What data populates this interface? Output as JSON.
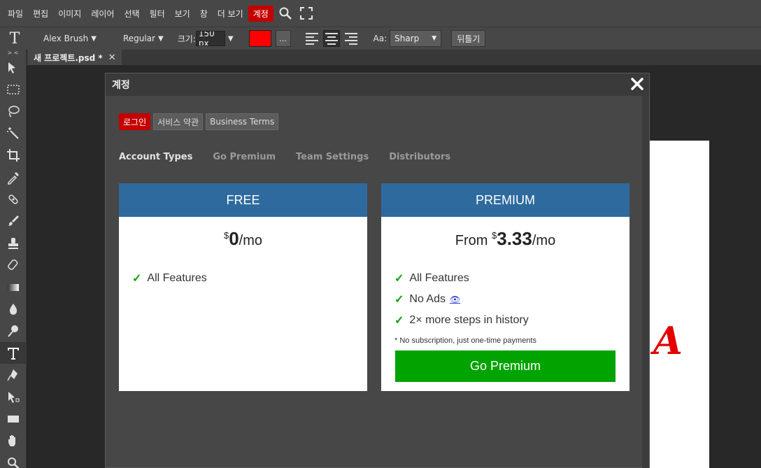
{
  "menu": {
    "items": [
      "파일",
      "편집",
      "이미지",
      "레이어",
      "선택",
      "필터",
      "보기",
      "창",
      "더 보기",
      "계정"
    ],
    "active": "계정"
  },
  "options": {
    "tool_glyph": "T",
    "font": "Alex Brush",
    "style": "Regular",
    "size_label": "크기:",
    "size_value": "150 px",
    "color": "#ff0000",
    "more_label": "...",
    "aa_label": "Aa:",
    "aa_value": "Sharp",
    "flip_label": "뒤틀기"
  },
  "document": {
    "tab_title": "새 프로젝트.psd *",
    "close_glyph": "✕",
    "canvas_text": "A"
  },
  "dialog": {
    "title": "계정",
    "tabs": [
      "로그인",
      "서비스 약관",
      "Business Terms"
    ],
    "subtabs": [
      "Account Types",
      "Go Premium",
      "Team Settings",
      "Distributors"
    ],
    "plans": {
      "free": {
        "title": "FREE",
        "prefix": "",
        "currency": "$",
        "amount": "0",
        "period": "/mo",
        "features": [
          "All Features"
        ]
      },
      "premium": {
        "title": "PREMIUM",
        "prefix": "From ",
        "currency": "$",
        "amount": "3.33",
        "period": "/mo",
        "features": [
          "All Features",
          "No Ads",
          "2× more steps in history"
        ],
        "note": "* No subscription, just one-time payments",
        "button": "Go Premium"
      }
    },
    "check_glyph": "✓",
    "eye_glyph": "👁"
  },
  "colors": {
    "accent_red": "#c40000",
    "card_header_blue": "#2e6a9e",
    "premium_green": "#00a300",
    "panel": "#474747",
    "workspace": "#282828"
  }
}
